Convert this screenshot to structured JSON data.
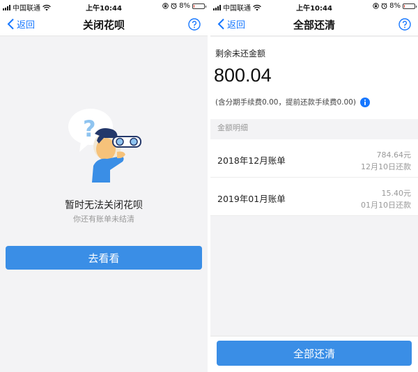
{
  "status_bar": {
    "carrier": "中国联通",
    "time": "上午10:44",
    "battery": "8%",
    "battery_level": 0.08
  },
  "left_screen": {
    "back_label": "返回",
    "title": "关闭花呗",
    "help_icon": "question-circle-icon",
    "empty_title": "暂时无法关闭花呗",
    "empty_subtitle": "你还有账单未结清",
    "button_label": "去看看"
  },
  "right_screen": {
    "back_label": "返回",
    "title": "全部还清",
    "remaining_label": "剩余未还金额",
    "remaining_amount": "800.04",
    "fee_note": "(含分期手续费0.00，提前还款手续费0.00)",
    "section_header": "金额明细",
    "bills": [
      {
        "month": "2018年12月账单",
        "amount": "784.64元",
        "due": "12月10日还款"
      },
      {
        "month": "2019年01月账单",
        "amount": "15.40元",
        "due": "01月10日还款"
      }
    ],
    "button_label": "全部还清"
  },
  "colors": {
    "accent": "#1677ff",
    "button": "#3a8ee6",
    "battery_low": "#e03020"
  }
}
